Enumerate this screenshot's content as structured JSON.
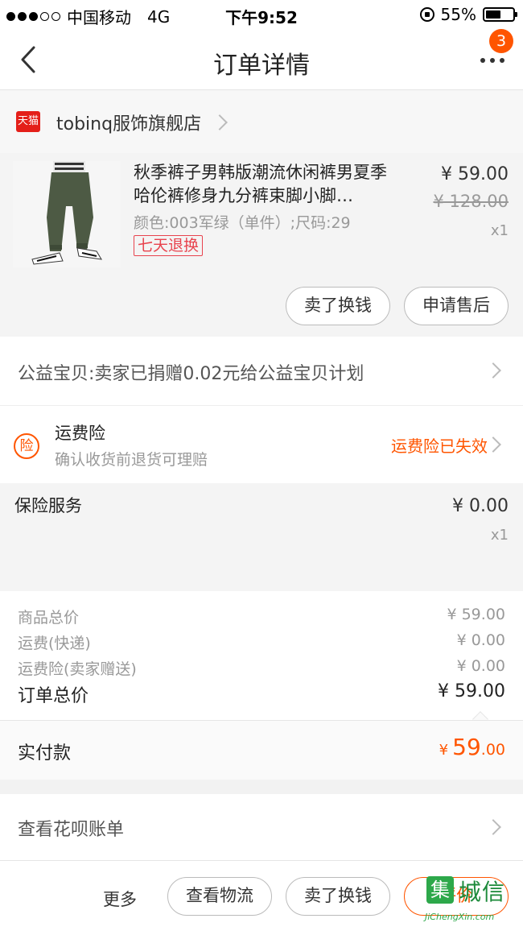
{
  "status_bar": {
    "carrier": "中国移动",
    "network": "4G",
    "time": "下午9:52",
    "battery_text": "55%",
    "battery_level": 0.55
  },
  "nav": {
    "title": "订单详情",
    "badge_count": "3",
    "back_icon": "chevron-left-icon",
    "more_icon": "more-dots-icon"
  },
  "store": {
    "badge": "天猫",
    "name": "tobinq服饰旗舰店"
  },
  "product": {
    "title": "秋季裤子男韩版潮流休闲裤男夏季哈伦裤修身九分裤束脚小脚…",
    "sku": "颜色:003军绿（单件）;尺码:29",
    "tag": "七天退换",
    "price": "¥ 59.00",
    "original_price": "¥ 128.00",
    "quantity": "x1",
    "buttons": [
      "卖了换钱",
      "申请售后"
    ]
  },
  "charity": {
    "text": "公益宝贝:卖家已捐赠0.02元给公益宝贝计划"
  },
  "shipping_insurance": {
    "icon_text": "险",
    "title": "运费险",
    "subtitle": "确认收货前退货可理赔",
    "status": "运费险已失效"
  },
  "insurance_service": {
    "title": "保险服务",
    "price": "¥ 0.00",
    "quantity": "x1"
  },
  "summary": {
    "rows": [
      {
        "label": "商品总价",
        "value": "¥ 59.00"
      },
      {
        "label": "运费(快递)",
        "value": "¥ 0.00"
      },
      {
        "label": "运费险(卖家赠送)",
        "value": "¥ 0.00"
      }
    ],
    "total_label": "订单总价",
    "total_value": "¥ 59.00"
  },
  "paid": {
    "label": "实付款",
    "currency": "¥",
    "integer": "59",
    "decimal": ".00"
  },
  "huabei": {
    "text": "查看花呗账单"
  },
  "bottom_bar": {
    "more": "更多",
    "buttons": [
      "查看物流",
      "卖了换钱",
      "评价"
    ]
  },
  "watermark": {
    "icon_text": "集",
    "text": "城信",
    "sub": "JiChengXin.com"
  },
  "colors": {
    "accent": "#ff5500",
    "tmall_red": "#e41f19",
    "return_tag": "#e8434e"
  }
}
